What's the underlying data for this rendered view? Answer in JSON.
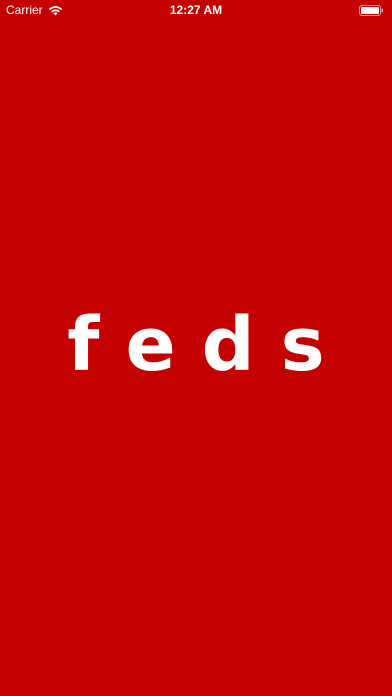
{
  "status_bar": {
    "carrier": "Carrier",
    "time": "12:27 AM",
    "wifi_icon": "wifi-icon",
    "battery_icon": "battery-icon"
  },
  "splash": {
    "logo_text": "feds"
  },
  "colors": {
    "background": "#c40202",
    "foreground": "#ffffff"
  }
}
